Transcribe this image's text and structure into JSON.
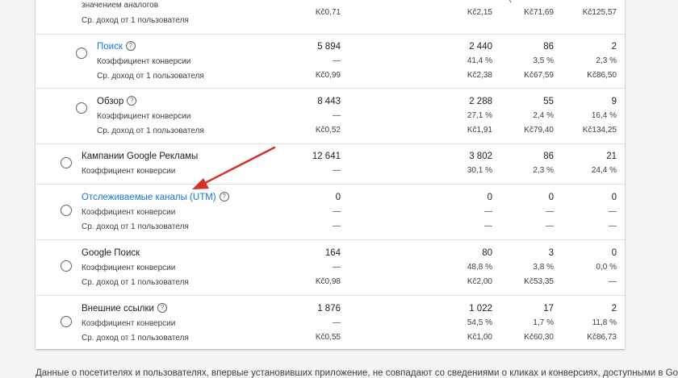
{
  "rows": [
    {
      "id": "analog",
      "title": "значением аналогов",
      "title_link": false,
      "has_help": false,
      "has_radio": false,
      "metrics": [
        {
          "label": "Ср. доход от 1  пользователя",
          "values": [
            "Kč0,71",
            "Kč2,15",
            "Kč71,69",
            "Kč125,57"
          ]
        }
      ]
    },
    {
      "id": "search",
      "title": "Поиск",
      "title_link": true,
      "has_help": true,
      "has_radio": true,
      "main_values": [
        "5 894",
        "2 440",
        "86",
        "2"
      ],
      "metrics": [
        {
          "label": "Коэффициент конверсии",
          "values": [
            "—",
            "41,4 %",
            "3,5 %",
            "2,3 %"
          ]
        },
        {
          "label": "Ср. доход от 1  пользователя",
          "values": [
            "Kč0,99",
            "Kč2,38",
            "Kč67,59",
            "Kč86,50"
          ]
        }
      ]
    },
    {
      "id": "overview",
      "title": "Обзор",
      "title_link": false,
      "has_help": true,
      "has_radio": true,
      "main_values": [
        "8 443",
        "2 288",
        "55",
        "9"
      ],
      "metrics": [
        {
          "label": "Коэффициент конверсии",
          "values": [
            "—",
            "27,1 %",
            "2,4 %",
            "16,4 %"
          ]
        },
        {
          "label": "Ср. доход от 1  пользователя",
          "values": [
            "Kč0,52",
            "Kč1,91",
            "Kč79,40",
            "Kč134,25"
          ]
        }
      ]
    },
    {
      "id": "google-ads",
      "title": "Кампании Google Рекламы",
      "title_link": false,
      "has_help": false,
      "has_radio": true,
      "main_values": [
        "12 641",
        "3 802",
        "86",
        "21"
      ],
      "metrics": [
        {
          "label": "Коэффициент конверсии",
          "values": [
            "—",
            "30,1 %",
            "2,3 %",
            "24,4 %"
          ]
        }
      ]
    },
    {
      "id": "utm",
      "title": "Отслеживаемые каналы (UTM)",
      "title_link": true,
      "has_help": true,
      "has_radio": true,
      "main_values": [
        "0",
        "0",
        "0",
        "0"
      ],
      "metrics": [
        {
          "label": "Коэффициент конверсии",
          "values": [
            "—",
            "—",
            "—",
            "—"
          ]
        },
        {
          "label": "Ср. доход от 1  пользователя",
          "values": [
            "—",
            "—",
            "—",
            "—"
          ]
        }
      ]
    },
    {
      "id": "google-search",
      "title": "Google Поиск",
      "title_link": false,
      "has_help": false,
      "has_radio": true,
      "main_values": [
        "164",
        "80",
        "3",
        "0"
      ],
      "metrics": [
        {
          "label": "Коэффициент конверсии",
          "values": [
            "—",
            "48,8 %",
            "3,8 %",
            "0,0 %"
          ]
        },
        {
          "label": "Ср. доход от 1  пользователя",
          "values": [
            "Kč0,98",
            "Kč2,00",
            "Kč53,35",
            "—"
          ]
        }
      ]
    },
    {
      "id": "external",
      "title": "Внешние ссылки",
      "title_link": false,
      "has_help": true,
      "has_radio": true,
      "main_values": [
        "1 876",
        "1 022",
        "17",
        "2"
      ],
      "metrics": [
        {
          "label": "Коэффициент конверсии",
          "values": [
            "—",
            "54,5 %",
            "1,7 %",
            "11,8 %"
          ]
        },
        {
          "label": "Ср. доход от 1  пользователя",
          "values": [
            "Kč0,55",
            "Kč1,00",
            "Kč60,30",
            "Kč86,73"
          ]
        }
      ]
    }
  ],
  "partial_top_value": "(",
  "footer_text": "Данные о посетителях и пользователях, впервые установивших приложение, не совпадают со сведениями о кликах и конверсиях, доступными в Google",
  "colors": {
    "link": "#1a73e8",
    "arrow": "#d93025"
  },
  "icons": {
    "radio": "radio-button-icon",
    "help": "help-circle-icon"
  }
}
